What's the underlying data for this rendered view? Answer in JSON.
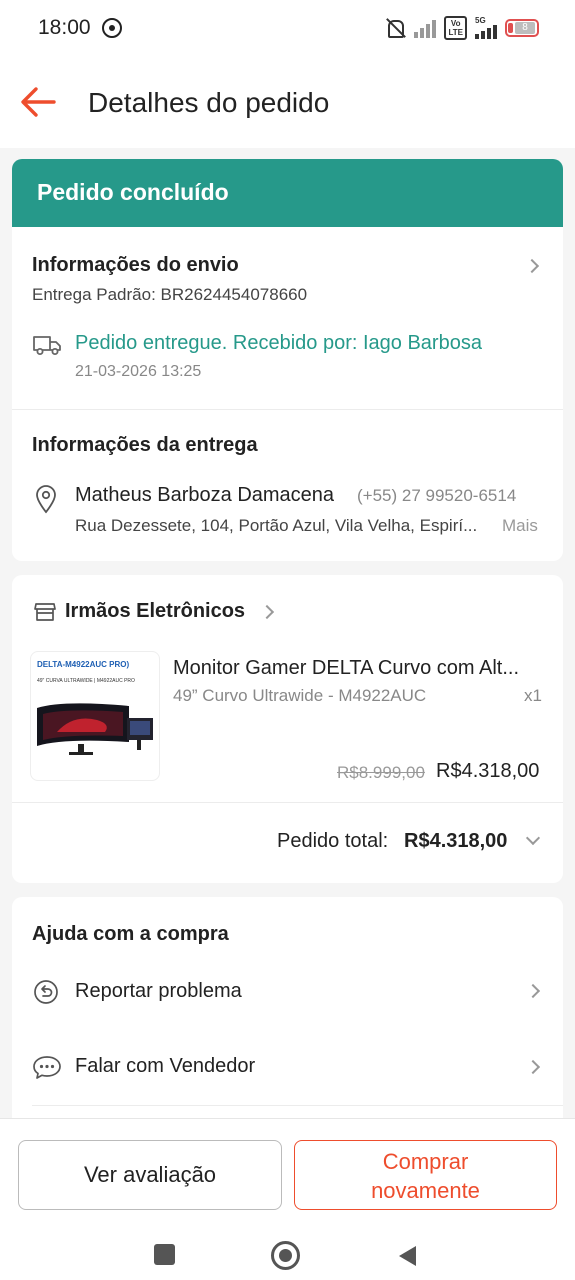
{
  "status_bar": {
    "time": "18:00",
    "network": "5G",
    "volte": "Vo LTE",
    "battery": "8",
    "icons": [
      "whatsapp-icon",
      "mute-icon",
      "signal-icon",
      "volte-icon",
      "signal-5g-icon",
      "battery-icon"
    ]
  },
  "header": {
    "title": "Detalhes do pedido",
    "back_icon": "arrow-left-icon",
    "accent": "#ee4d2d"
  },
  "status_banner": {
    "text": "Pedido concluído",
    "color": "#26998a"
  },
  "shipping": {
    "title": "Informações do envio",
    "method": "Entrega Padrão: BR2624454078660",
    "status": "Pedido entregue. Recebido por: Iago Barbosa",
    "timestamp": "21-03-2026 13:25"
  },
  "delivery": {
    "title": "Informações da entrega",
    "name": "Matheus Barboza Damacena",
    "phone": "(+55) 27 99520-6514",
    "address": "Rua Dezessete, 104, Portão Azul, Vila Velha, Espirí...",
    "more": "Mais"
  },
  "seller": {
    "name": "Irmãos Eletrônicos"
  },
  "product": {
    "title": "Monitor Gamer DELTA Curvo com Alt...",
    "variant": "49” Curvo Ultrawide - M4922AUC",
    "quantity": "x1",
    "original_price": "R$8.999,00",
    "price": "R$4.318,00",
    "thumb_text_1": "DELTA-M4922AUC PRO)",
    "thumb_text_2": "49\" CURVA ULTRAWIDE | M4922AUC PRO"
  },
  "order_total": {
    "label": "Pedido total:",
    "value": "R$4.318,00"
  },
  "help": {
    "title": "Ajuda com a compra",
    "items": [
      {
        "label": "Reportar problema",
        "icon": "report-icon"
      },
      {
        "label": "Falar com Vendedor",
        "icon": "chat-icon"
      }
    ]
  },
  "actions": {
    "review": "Ver avaliação",
    "buy_again_line1": "Comprar",
    "buy_again_line2": "novamente"
  }
}
